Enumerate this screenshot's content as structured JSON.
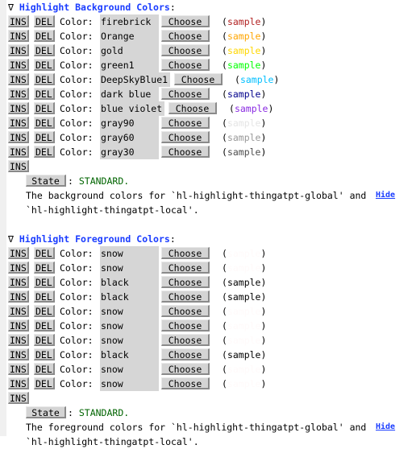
{
  "background_section": {
    "title": "Highlight Background Colors",
    "toggle_glyph": "∇",
    "rows": [
      {
        "value": "firebrick",
        "sample_color": "#b22222"
      },
      {
        "value": "Orange",
        "sample_color": "#ffa500"
      },
      {
        "value": "gold",
        "sample_color": "#ffd700"
      },
      {
        "value": "green1",
        "sample_color": "#00ff00"
      },
      {
        "value": "DeepSkyBlue1",
        "sample_color": "#00bfff"
      },
      {
        "value": "dark blue",
        "sample_color": "#00008b"
      },
      {
        "value": "blue violet",
        "sample_color": "#8a2be2"
      },
      {
        "value": "gray90",
        "sample_color": "#e5e5e5"
      },
      {
        "value": "gray60",
        "sample_color": "#999999"
      },
      {
        "value": "gray30",
        "sample_color": "#4d4d4d"
      }
    ],
    "state_label": "State",
    "state_value": "STANDARD.",
    "doc_line1": "The background colors for `hl-highlight-thingatpt-global' and",
    "doc_line2": "`hl-highlight-thingatpt-local'.",
    "hide_label": "Hide"
  },
  "foreground_section": {
    "title": "Highlight Foreground Colors",
    "toggle_glyph": "∇",
    "rows": [
      {
        "value": "snow",
        "sample_color": "#fffafa"
      },
      {
        "value": "snow",
        "sample_color": "#fffafa"
      },
      {
        "value": "black",
        "sample_color": "#000000"
      },
      {
        "value": "black",
        "sample_color": "#000000"
      },
      {
        "value": "snow",
        "sample_color": "#fffafa"
      },
      {
        "value": "snow",
        "sample_color": "#fffafa"
      },
      {
        "value": "snow",
        "sample_color": "#fffafa"
      },
      {
        "value": "black",
        "sample_color": "#000000"
      },
      {
        "value": "snow",
        "sample_color": "#fffafa"
      },
      {
        "value": "snow",
        "sample_color": "#fffafa"
      }
    ],
    "state_label": "State",
    "state_value": "STANDARD.",
    "doc_line1": "The foreground colors for `hl-highlight-thingatpt-global' and",
    "doc_line2": "`hl-highlight-thingatpt-local'.",
    "hide_label": "Hide"
  },
  "labels": {
    "ins": "INS",
    "del": "DEL",
    "color": "Color:",
    "choose": "Choose",
    "sample": "sample",
    "open_paren": "(",
    "close_paren": ")",
    "state_colon": ": "
  }
}
